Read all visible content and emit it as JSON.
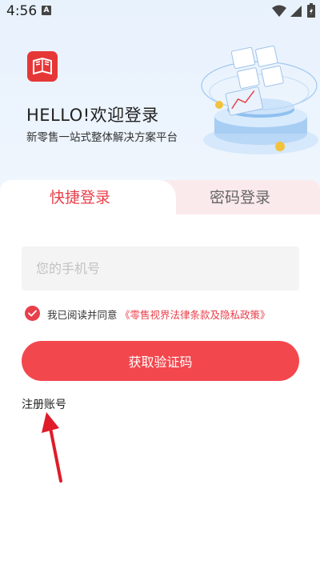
{
  "status_bar": {
    "time": "4:56",
    "notification_badge": "A"
  },
  "header": {
    "greeting": "HELLO!欢迎登录",
    "subtitle": "新零售一站式整体解决方案平台"
  },
  "tabs": [
    {
      "label": "快捷登录",
      "active": true
    },
    {
      "label": "密码登录",
      "active": false
    }
  ],
  "form": {
    "phone_placeholder": "您的手机号",
    "phone_value": "",
    "agreement_checked": true,
    "agreement_prefix": "我已阅读并同意",
    "agreement_link": "《零售视界法律条款及隐私政策》",
    "submit_label": "获取验证码",
    "register_label": "注册账号"
  },
  "colors": {
    "accent": "#e8404b",
    "button": "#f3474e",
    "logo": "#e63737"
  },
  "icons": [
    "wifi-icon",
    "signal-icon",
    "battery-icon",
    "logo-icon",
    "check-icon",
    "arrow-icon"
  ]
}
